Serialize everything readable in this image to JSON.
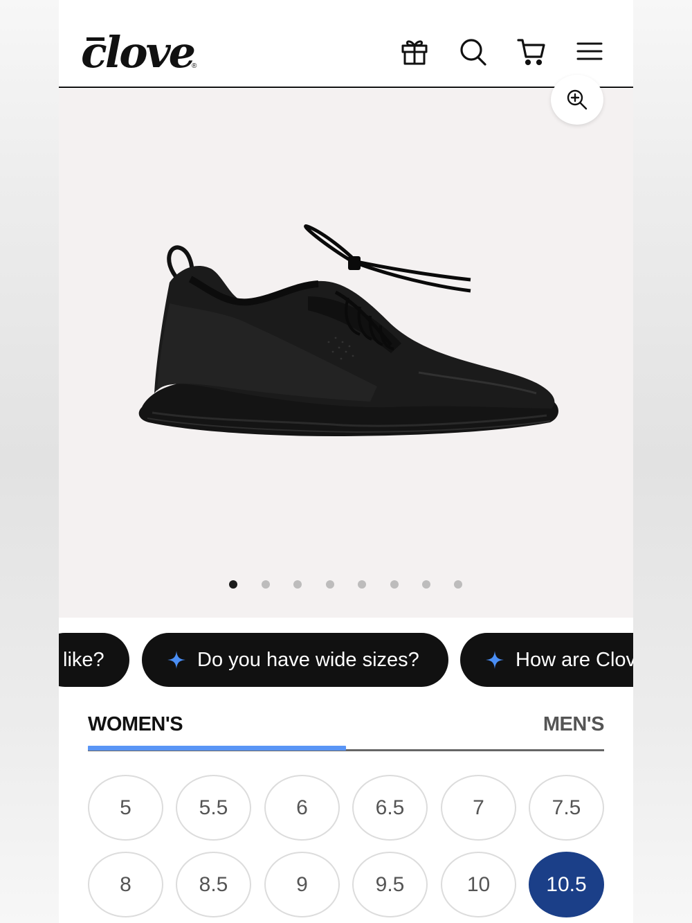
{
  "header": {
    "logo_text": "clove",
    "logo_registered": "®",
    "icons": [
      "gift-icon",
      "search-icon",
      "cart-icon",
      "menu-icon"
    ]
  },
  "gallery": {
    "zoom_icon": "zoom-in-icon",
    "image_count": 8,
    "active_index": 0
  },
  "chips": [
    {
      "label": "like?"
    },
    {
      "label": "Do you have wide sizes?"
    },
    {
      "label": "How are Clov"
    }
  ],
  "size_tabs": {
    "women_label": "WOMEN'S",
    "men_label": "MEN'S",
    "active": "women"
  },
  "sizes": [
    "5",
    "5.5",
    "6",
    "6.5",
    "7",
    "7.5",
    "8",
    "8.5",
    "9",
    "9.5",
    "10",
    "10.5"
  ],
  "selected_size": "10.5",
  "colors": {
    "accent_blue": "#5a95f5",
    "selected_size_bg": "#1b3f88",
    "chip_bg": "#111111",
    "gallery_bg": "#f4f1f1"
  }
}
